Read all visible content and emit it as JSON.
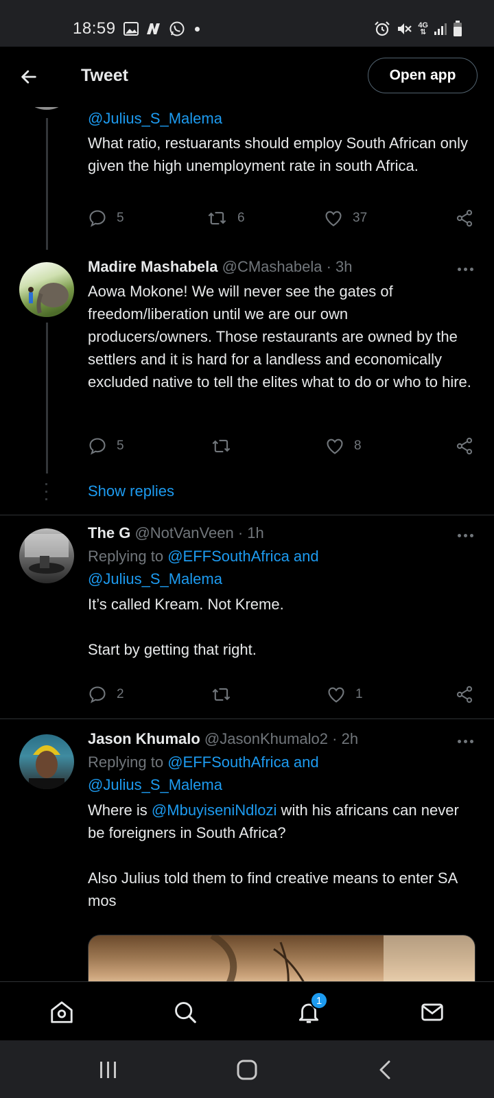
{
  "status_bar": {
    "time": "18:59",
    "network": "4G"
  },
  "header": {
    "title": "Tweet",
    "open_app_label": "Open app"
  },
  "tweets": [
    {
      "handle_link": "@Julius_S_Malema",
      "text": "What ratio, restuarants should employ South African only given the high unemployment rate in south Africa.",
      "replies": "5",
      "retweets": "6",
      "likes": "37"
    },
    {
      "name": "Madire Mashabela",
      "meta": " @CMashabela · 3h",
      "text": "Aowa Mokone! We will never see the gates of freedom/liberation until we are our own producers/owners. Those restaurants are owned by the settlers and it is hard for a landless and economically excluded native to tell the elites what to do or who to hire.",
      "replies": "5",
      "retweets": "",
      "likes": "8"
    },
    {
      "name": "The G",
      "meta": " @NotVanVeen · 1h",
      "replying_prefix": "Replying to ",
      "replying_1": "@EFFSouthAfrica and",
      "replying_2": "@Julius_S_Malema",
      "text_1": "It’s called Kream. Not Kreme.",
      "text_2": "Start by getting that right.",
      "replies": "2",
      "retweets": "",
      "likes": "1"
    },
    {
      "name": "Jason Khumalo",
      "meta": " @JasonKhumalo2 · 2h",
      "replying_prefix": "Replying to ",
      "replying_1": "@EFFSouthAfrica and",
      "replying_2": "@Julius_S_Malema",
      "text_pre": "Where is ",
      "text_mention": "@MbuyiseniNdlozi",
      "text_post": " with his africans can never be foreigners in South Africa?",
      "text_2": "Also Julius told them to find creative means to enter SA mos"
    }
  ],
  "show_replies": "Show replies",
  "bottom_nav": {
    "notifications_badge": "1"
  },
  "colors": {
    "accent": "#1d9bf0",
    "background": "#000000",
    "muted": "#71767b"
  }
}
